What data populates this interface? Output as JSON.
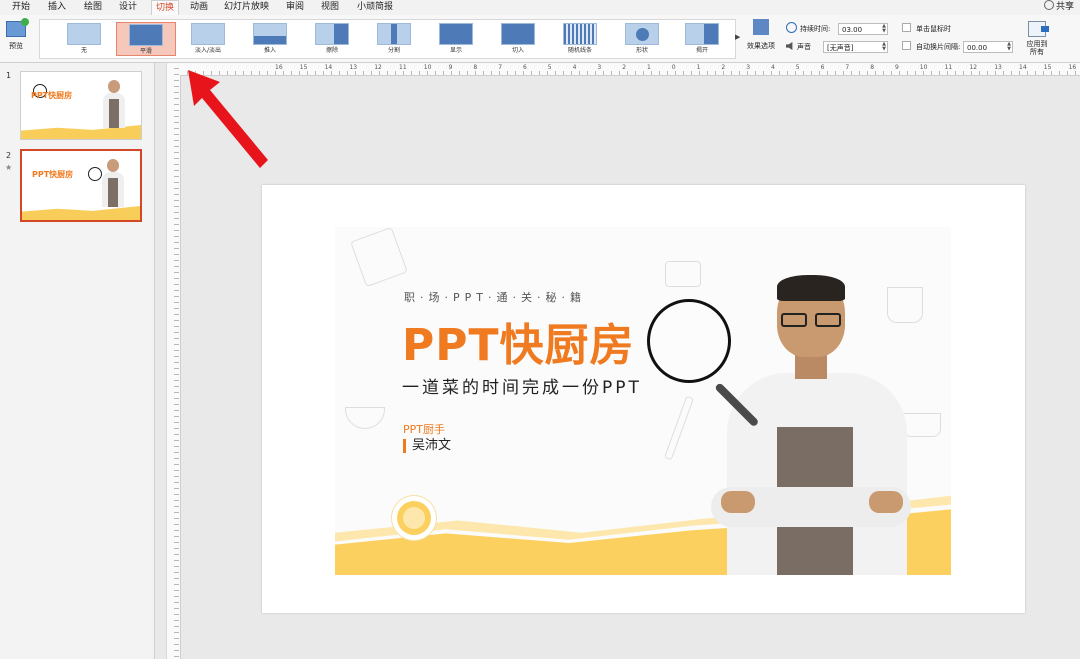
{
  "menu": {
    "tabs": [
      "开始",
      "插入",
      "绘图",
      "设计",
      "切换",
      "动画",
      "幻灯片放映",
      "审阅",
      "视图",
      "小顽简报"
    ],
    "active_tab": "切换",
    "share": "共享"
  },
  "ribbon": {
    "preview_label": "预览",
    "transitions": [
      "无",
      "平滑",
      "淡入/淡出",
      "推入",
      "擦除",
      "分割",
      "显示",
      "切入",
      "随机线条",
      "形状",
      "揭开"
    ],
    "selected_transition": "平滑",
    "effect_options": "效果选项",
    "duration_label": "持续时间:",
    "duration_value": "03.00",
    "sound_label": "声音",
    "sound_value": "[无声音]",
    "on_click_label": "单击鼠标时",
    "after_label": "自动换片间隔:",
    "after_value": "00.00",
    "apply_all_label": "应用到所有"
  },
  "slides_pane": {
    "slides": [
      {
        "number": "1",
        "title": "PPT快厨房"
      },
      {
        "number": "2",
        "title": "PPT快厨房",
        "star": "★"
      }
    ],
    "selected_slide": 2
  },
  "rulers": {
    "h_ticks": [
      "16",
      "15",
      "14",
      "13",
      "12",
      "11",
      "10",
      "9",
      "8",
      "7",
      "6",
      "5",
      "4",
      "3",
      "2",
      "1",
      "0",
      "1",
      "2",
      "3",
      "4",
      "5",
      "6",
      "7",
      "8",
      "9",
      "10",
      "11",
      "12",
      "13",
      "14",
      "15",
      "16"
    ]
  },
  "slide": {
    "kicker": "职·场·PPT·通·关·秘·籍",
    "title": "PPT快厨房",
    "subtitle": "一道菜的时间完成一份PPT",
    "role": "PPT厨手",
    "author": "吴沛文",
    "accent_color": "#f07a1f",
    "wave_color": "#fbd05f"
  },
  "colors": {
    "selection": "#d24726",
    "arrow": "#e8141b"
  }
}
